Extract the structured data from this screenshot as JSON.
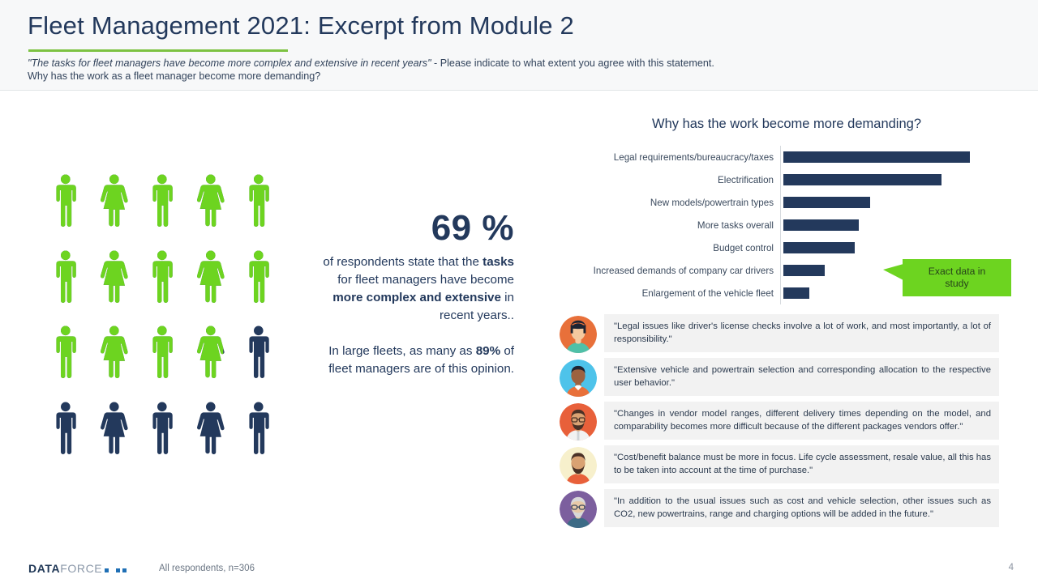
{
  "header": {
    "title": "Fleet Management 2021: Excerpt from Module 2",
    "subtitle_quote": "\"The tasks for fleet managers have become more complex and extensive in recent years\"",
    "subtitle_rest": " - Please indicate to what extent you agree with this statement.",
    "subtitle_line2": "Why has the work as a fleet manager become more demanding?",
    "accent_color": "#7dc242"
  },
  "pictogram": {
    "total_figures": 20,
    "filled_figures": 13.8,
    "fill_color": "#6dd420",
    "empty_color": "#23395c",
    "figures": [
      {
        "gender": "male",
        "fill": 1
      },
      {
        "gender": "female",
        "fill": 1
      },
      {
        "gender": "male",
        "fill": 1
      },
      {
        "gender": "female",
        "fill": 1
      },
      {
        "gender": "male",
        "fill": 1
      },
      {
        "gender": "male",
        "fill": 1
      },
      {
        "gender": "female",
        "fill": 1
      },
      {
        "gender": "male",
        "fill": 1
      },
      {
        "gender": "female",
        "fill": 1
      },
      {
        "gender": "male",
        "fill": 1
      },
      {
        "gender": "male",
        "fill": 1
      },
      {
        "gender": "female",
        "fill": 1
      },
      {
        "gender": "male",
        "fill": 1
      },
      {
        "gender": "female",
        "fill": 0.8
      },
      {
        "gender": "male",
        "fill": 0
      },
      {
        "gender": "male",
        "fill": 0
      },
      {
        "gender": "female",
        "fill": 0
      },
      {
        "gender": "male",
        "fill": 0
      },
      {
        "gender": "female",
        "fill": 0
      },
      {
        "gender": "male",
        "fill": 0
      }
    ]
  },
  "stat": {
    "big_number": "69 %",
    "line1_a": "of respondents state that the ",
    "line1_b": "tasks",
    "line1_c": " for fleet managers have become ",
    "line1_d": "more complex and extensive",
    "line1_e": " in recent years..",
    "line2_a": "In large fleets, as many as ",
    "line2_b": "89%",
    "line2_c": " of fleet managers are of this opinion."
  },
  "chart_data": {
    "type": "bar",
    "orientation": "horizontal",
    "title": "Why has the work become more demanding?",
    "xlabel": "",
    "ylabel": "",
    "grid": false,
    "legend": false,
    "bar_color": "#23395c",
    "axis_color": "#d7dbdf",
    "xlim": [
      0,
      100
    ],
    "categories": [
      "Legal requirements/bureaucracy/taxes",
      "Electrification",
      "New models/powertrain types",
      "More tasks overall",
      "Budget control",
      "Increased demands of company car drivers",
      "Enlargement of the vehicle fleet"
    ],
    "values": [
      86,
      73,
      40,
      35,
      33,
      19,
      12
    ],
    "annotations": [
      {
        "text": "Exact data in study",
        "color": "#6dd420",
        "points_to": "chart"
      }
    ]
  },
  "callout": {
    "line1": "Exact data in",
    "line2": "study",
    "color": "#6dd420"
  },
  "quotes": [
    {
      "avatar": "avatar-woman-dark-hair",
      "text": "\"Legal issues like driver's license checks involve a lot of work, and most importantly, a lot of responsibility.\""
    },
    {
      "avatar": "avatar-man-blue-background",
      "text": "\"Extensive vehicle and powertrain selection and corresponding allocation to the respective user behavior.\""
    },
    {
      "avatar": "avatar-man-glasses-beard",
      "text": "\"Changes in vendor model ranges, different delivery times depending on the model, and comparability becomes more difficult because of the different packages vendors offer.\""
    },
    {
      "avatar": "avatar-man-beard-cream-background",
      "text": "\"Cost/benefit balance must be more in focus. Life cycle assessment, resale value, all this has to be taken into account at the time of purchase.\""
    },
    {
      "avatar": "avatar-senior-man-glasses",
      "text": "\"In addition to the usual issues such as cost and vehicle selection, other issues such as CO2, new powertrains, range and charging options will be added in the future.\""
    }
  ],
  "footer": {
    "logo_bold": "DATA",
    "logo_light": "FORCE",
    "footnote": "All respondents,  n=306",
    "page_number": "4"
  }
}
